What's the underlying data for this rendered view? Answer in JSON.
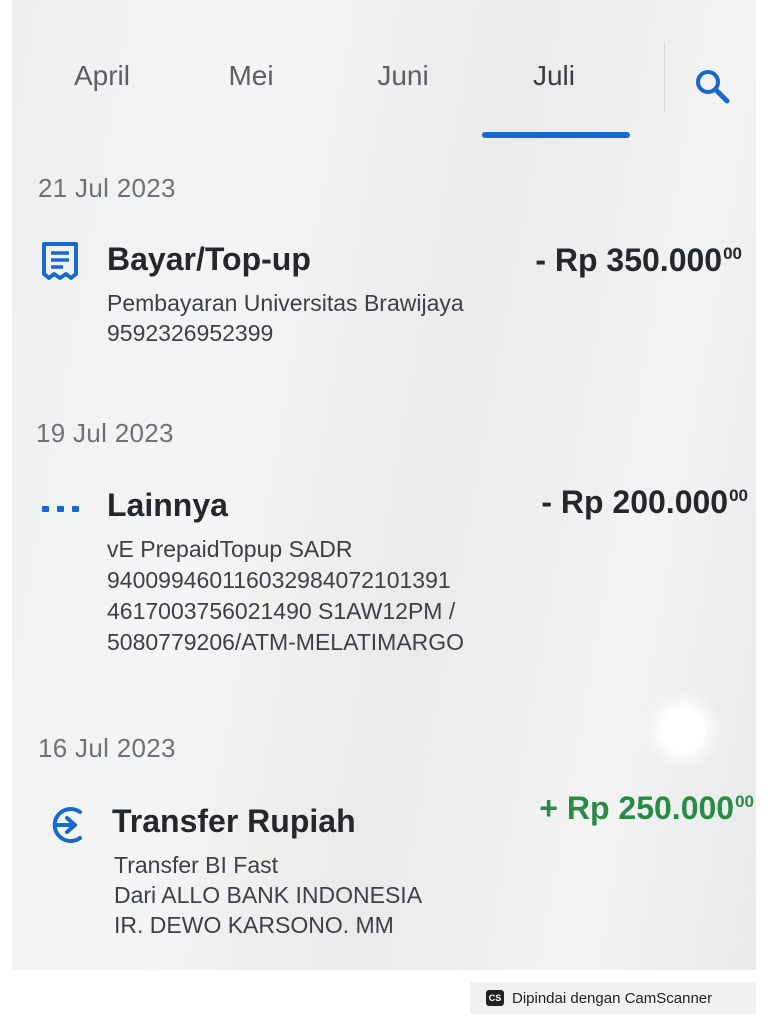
{
  "tabs": {
    "items": [
      {
        "label": "April"
      },
      {
        "label": "Mei"
      },
      {
        "label": "Juni"
      },
      {
        "label": "Juli"
      }
    ],
    "active": "Juli",
    "search_icon": "search-icon"
  },
  "groups": [
    {
      "date": "21 Jul 2023",
      "transaction": {
        "icon": "receipt-icon",
        "title": "Bayar/Top-up",
        "amount": "- Rp 350.000",
        "amount_cents": "00",
        "type": "debit",
        "details": [
          "Pembayaran Universitas Brawijaya",
          "9592326952399"
        ]
      }
    },
    {
      "date": "19 Jul 2023",
      "transaction": {
        "icon": "more-dots-icon",
        "title": "Lainnya",
        "amount": "- Rp 200.000",
        "amount_cents": "00",
        "type": "debit",
        "details": [
          "vE PrepaidTopup SADR",
          "940099460116032984072101391",
          "4617003756021490 S1AW12PM  /",
          "5080779206/ATM-MELATIMARGO"
        ]
      }
    },
    {
      "date": "16 Jul 2023",
      "transaction": {
        "icon": "transfer-in-icon",
        "title": "Transfer Rupiah",
        "amount": "+ Rp 250.000",
        "amount_cents": "00",
        "type": "credit",
        "details": [
          "Transfer BI Fast",
          "Dari ALLO BANK INDONESIA",
          "IR. DEWO KARSONO. MM"
        ]
      }
    }
  ],
  "colors": {
    "accent": "#1868d2",
    "credit": "#2b8a47",
    "text": "#24272c"
  },
  "watermark": {
    "logo": "CS",
    "text": "Dipindai dengan CamScanner"
  }
}
